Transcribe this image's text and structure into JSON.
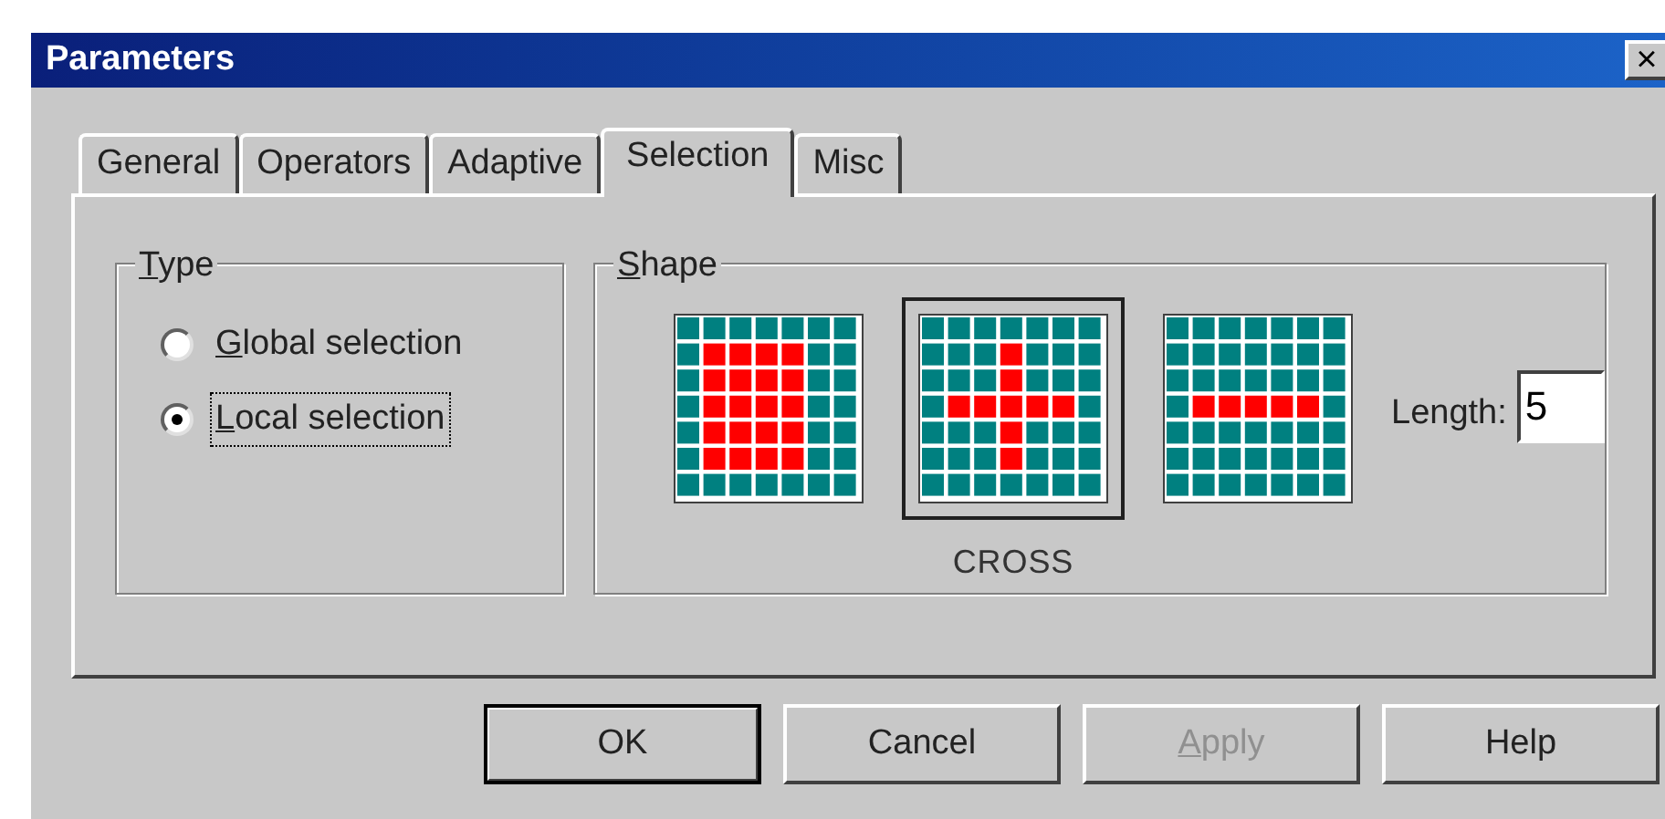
{
  "window": {
    "title": "Parameters",
    "close": "×"
  },
  "tabs": [
    {
      "label": "General",
      "selected": false
    },
    {
      "label": "Operators",
      "selected": false
    },
    {
      "label": "Adaptive",
      "selected": false
    },
    {
      "label": "Selection",
      "selected": true
    },
    {
      "label": "Misc",
      "selected": false
    }
  ],
  "type_group": {
    "title": "Type",
    "options": [
      {
        "label": "Global selection",
        "selected": false
      },
      {
        "label": "Local selection",
        "selected": true
      }
    ]
  },
  "shape_group": {
    "title": "Shape",
    "shapes": [
      {
        "kind": "block",
        "selected": false
      },
      {
        "kind": "cross",
        "selected": true
      },
      {
        "kind": "line",
        "selected": false
      }
    ],
    "selected_name": "CROSS",
    "length": {
      "label": "Length:",
      "value": "5"
    }
  },
  "buttons": [
    {
      "label": "OK",
      "default": true,
      "disabled": false
    },
    {
      "label": "Cancel",
      "default": false,
      "disabled": false
    },
    {
      "label": "Apply",
      "default": false,
      "disabled": true
    },
    {
      "label": "Help",
      "default": false,
      "disabled": false
    }
  ]
}
